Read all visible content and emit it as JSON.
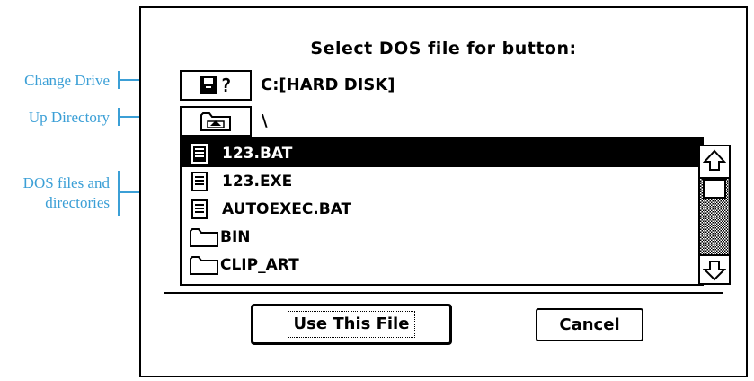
{
  "callouts": {
    "change_drive": "Change Drive",
    "up_directory": "Up Directory",
    "dos_files_line1": "DOS files and",
    "dos_files_line2": "directories",
    "color": "#3b9fd6"
  },
  "dialog": {
    "title": "Select DOS file for button:",
    "drive_button_label": "?",
    "drive_path": "C:[HARD DISK]",
    "current_dir": "\\",
    "files": [
      {
        "name": "123.BAT",
        "type": "file",
        "selected": true
      },
      {
        "name": "123.EXE",
        "type": "file",
        "selected": false
      },
      {
        "name": "AUTOEXEC.BAT",
        "type": "file",
        "selected": false
      },
      {
        "name": "BIN",
        "type": "folder",
        "selected": false
      },
      {
        "name": "CLIP_ART",
        "type": "folder",
        "selected": false
      }
    ],
    "use_button": "Use This File",
    "cancel_button": "Cancel"
  }
}
